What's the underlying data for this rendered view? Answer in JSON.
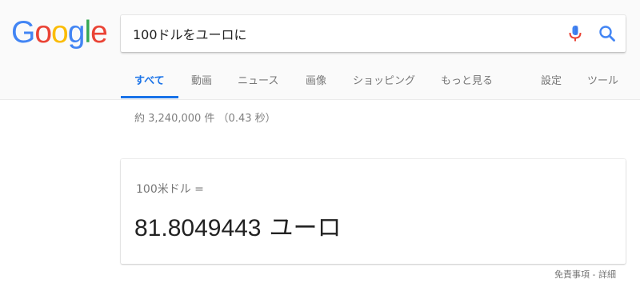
{
  "logo": {
    "letters": [
      {
        "char": "G",
        "color": "#4285F4"
      },
      {
        "char": "o",
        "color": "#EA4335"
      },
      {
        "char": "o",
        "color": "#FBBC05"
      },
      {
        "char": "g",
        "color": "#4285F4"
      },
      {
        "char": "l",
        "color": "#34A853"
      },
      {
        "char": "e",
        "color": "#EA4335"
      }
    ]
  },
  "search": {
    "value": "100ドルをユーロに",
    "mic_icon": "microphone-icon",
    "search_icon": "magnifier-icon"
  },
  "tabs": {
    "all": "すべて",
    "videos": "動画",
    "news": "ニュース",
    "images": "画像",
    "shopping": "ショッピング",
    "more": "もっと見る",
    "settings": "設定",
    "tools": "ツール"
  },
  "stats": "約 3,240,000 件 （0.43 秒）",
  "converter": {
    "from": "100米ドル =",
    "amount": "81.8049443",
    "unit": "ユーロ"
  },
  "footer": {
    "disclaimer": "免責事項",
    "separator": " - ",
    "details": "詳細"
  },
  "colors": {
    "accent": "#1a73e8",
    "mic_blue": "#4285F4",
    "mic_red": "#EA4335"
  }
}
